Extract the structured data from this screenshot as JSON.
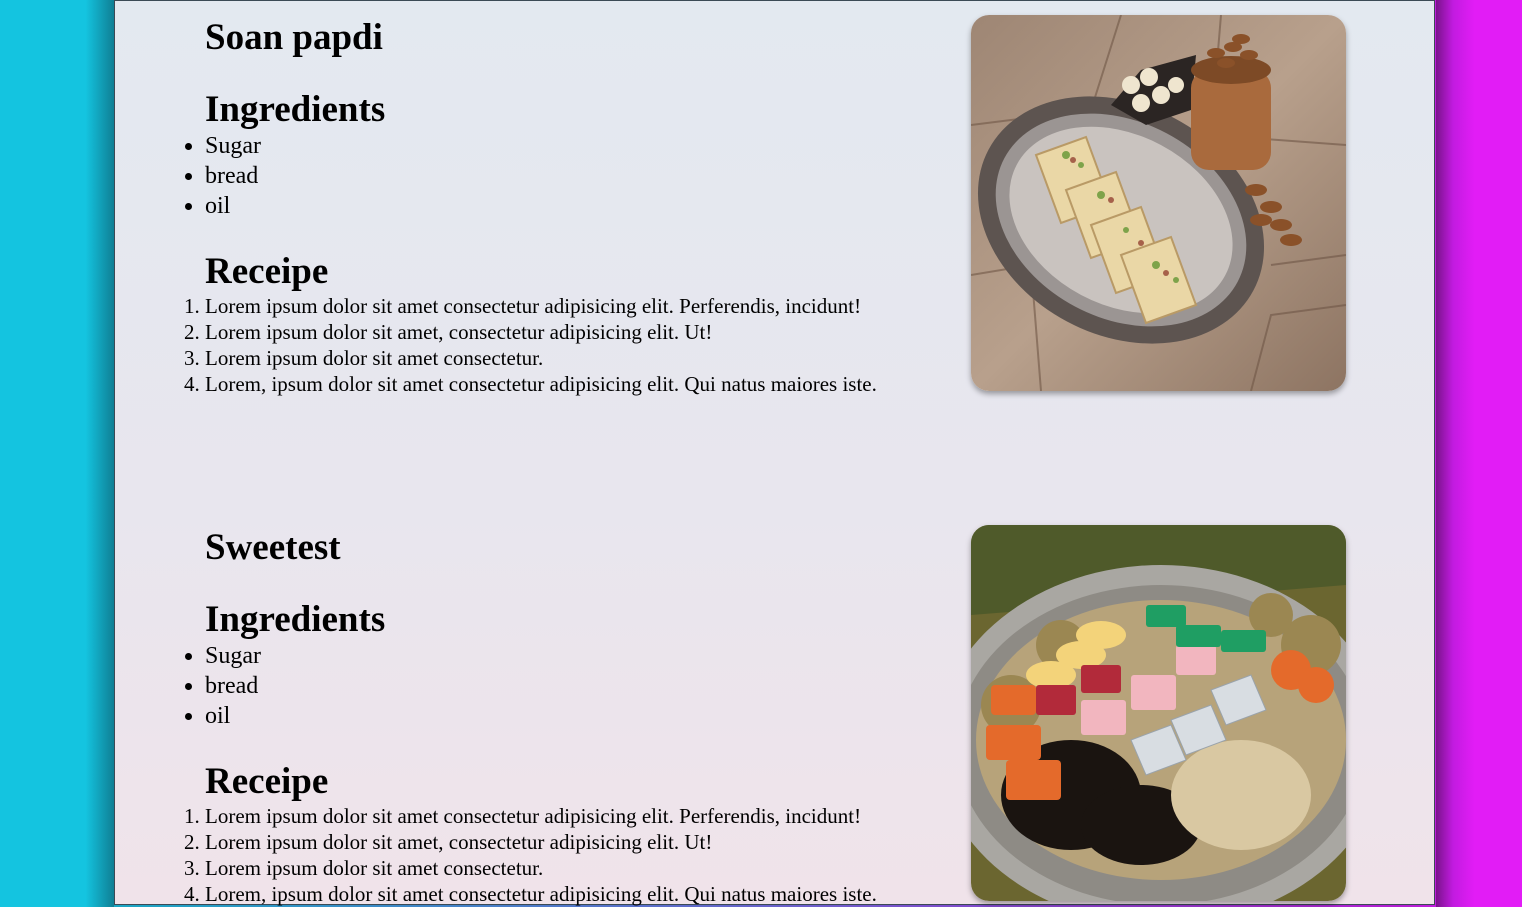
{
  "recipes": [
    {
      "title": "Soan papdi",
      "ingredients_heading": "Ingredients",
      "ingredients": [
        "Sugar",
        "bread",
        "oil"
      ],
      "recipe_heading": "Receipe",
      "steps": [
        "Lorem ipsum dolor sit amet consectetur adipisicing elit. Perferendis, incidunt!",
        "Lorem ipsum dolor sit amet, consectetur adipisicing elit. Ut!",
        "Lorem ipsum dolor sit amet consectetur.",
        "Lorem, ipsum dolor sit amet consectetur adipisicing elit. Qui natus maiores iste."
      ],
      "image": "soan-papdi-photo"
    },
    {
      "title": "Sweetest",
      "ingredients_heading": "Ingredients",
      "ingredients": [
        "Sugar",
        "bread",
        "oil"
      ],
      "recipe_heading": "Receipe",
      "steps": [
        "Lorem ipsum dolor sit amet consectetur adipisicing elit. Perferendis, incidunt!",
        "Lorem ipsum dolor sit amet, consectetur adipisicing elit. Ut!",
        "Lorem ipsum dolor sit amet consectetur.",
        "Lorem, ipsum dolor sit amet consectetur adipisicing elit. Qui natus maiores iste."
      ],
      "image": "mixed-sweets-platter-photo"
    }
  ],
  "colors": {
    "left_side": "#14c4e0",
    "right_side": "#e21cf6",
    "sheet_top": "#e3e9f0",
    "sheet_bottom": "#f0e3ea"
  }
}
